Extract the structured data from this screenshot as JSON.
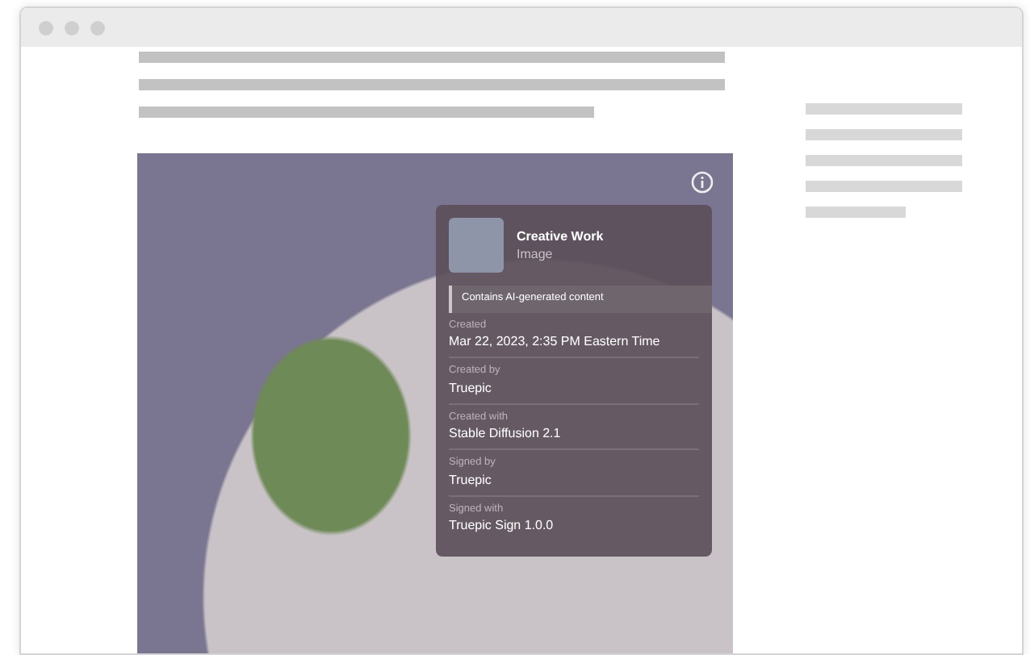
{
  "content_credentials": {
    "title": "Creative Work",
    "type": "Image",
    "notice": "Contains AI-generated content",
    "fields": [
      {
        "label": "Created",
        "value": "Mar 22, 2023, 2:35 PM Eastern Time"
      },
      {
        "label": "Created by",
        "value": "Truepic"
      },
      {
        "label": "Created with",
        "value": "Stable Diffusion 2.1"
      },
      {
        "label": "Signed by",
        "value": "Truepic"
      },
      {
        "label": "Signed with",
        "value": "Truepic Sign 1.0.0"
      }
    ]
  }
}
